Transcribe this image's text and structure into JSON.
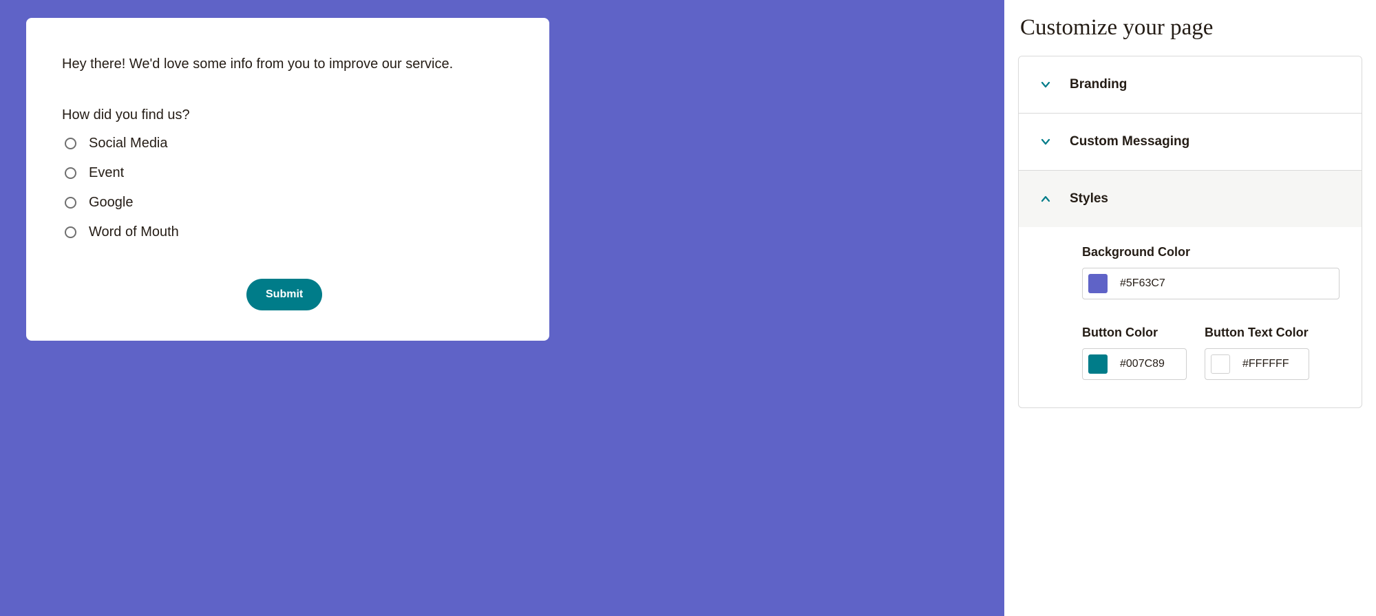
{
  "styles": {
    "background_color": "#5F63C7",
    "button_color": "#007C89",
    "button_text_color": "#FFFFFF"
  },
  "preview": {
    "intro": "Hey there! We'd love some info from you to improve our service.",
    "question": "How did you find us?",
    "options": [
      "Social Media",
      "Event",
      "Google",
      "Word of Mouth"
    ],
    "submit_label": "Submit"
  },
  "panel": {
    "title": "Customize your page",
    "sections": {
      "branding": {
        "label": "Branding",
        "open": false
      },
      "messaging": {
        "label": "Custom Messaging",
        "open": false
      },
      "styles": {
        "label": "Styles",
        "open": true
      }
    },
    "fields": {
      "bg_label": "Background Color",
      "btn_label": "Button Color",
      "btn_text_label": "Button Text Color"
    }
  }
}
